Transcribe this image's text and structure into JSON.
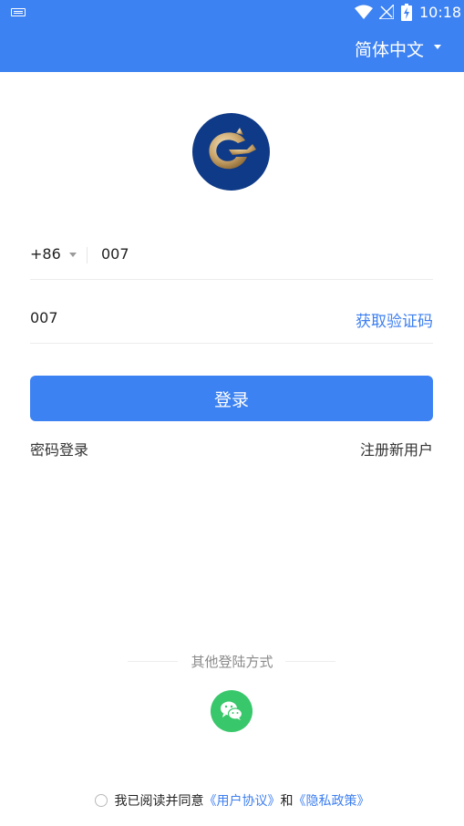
{
  "status_bar": {
    "time": "10:18"
  },
  "header": {
    "language": "简体中文"
  },
  "form": {
    "country_code": "+86",
    "phone_value": "007",
    "code_value": "007",
    "get_code_label": "获取验证码",
    "login_label": "登录",
    "password_login_label": "密码登录",
    "register_label": "注册新用户"
  },
  "other_login": {
    "title": "其他登陆方式"
  },
  "agreement": {
    "prefix": "我已阅读并同意",
    "user_agreement": "《用户协议》",
    "and": "和",
    "privacy_policy": "《隐私政策》"
  },
  "colors": {
    "primary": "#3d82f2",
    "link": "#3d7ff0",
    "wechat": "#38c76a",
    "logo_bg": "#0f3a87"
  }
}
